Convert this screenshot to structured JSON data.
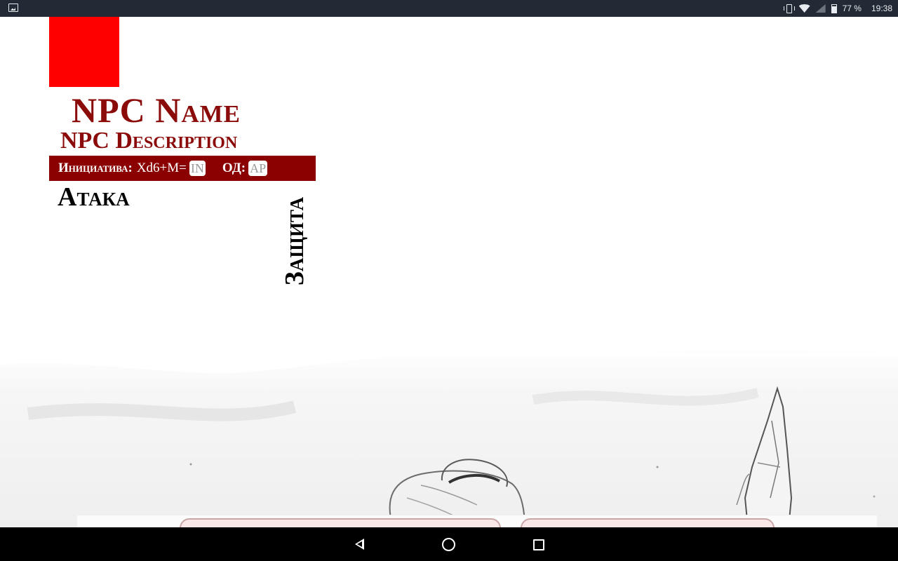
{
  "status_bar": {
    "battery": "77 %",
    "time": "19:38"
  },
  "npc": {
    "name": "NPC Name",
    "description": "NPC Description",
    "portrait_color": "#ff0000"
  },
  "initiative": {
    "label": "Инициатива:",
    "formula": "Xd6+M=",
    "in_value": "IN",
    "ap_label": "ОД:",
    "ap_value": "AP"
  },
  "sections": {
    "attack": "Атака",
    "defense": "Защита"
  },
  "colors": {
    "accent": "#8b0a0a",
    "bar": "#8b0000",
    "status_bar": "#232a35",
    "nav_bar": "#000000"
  }
}
